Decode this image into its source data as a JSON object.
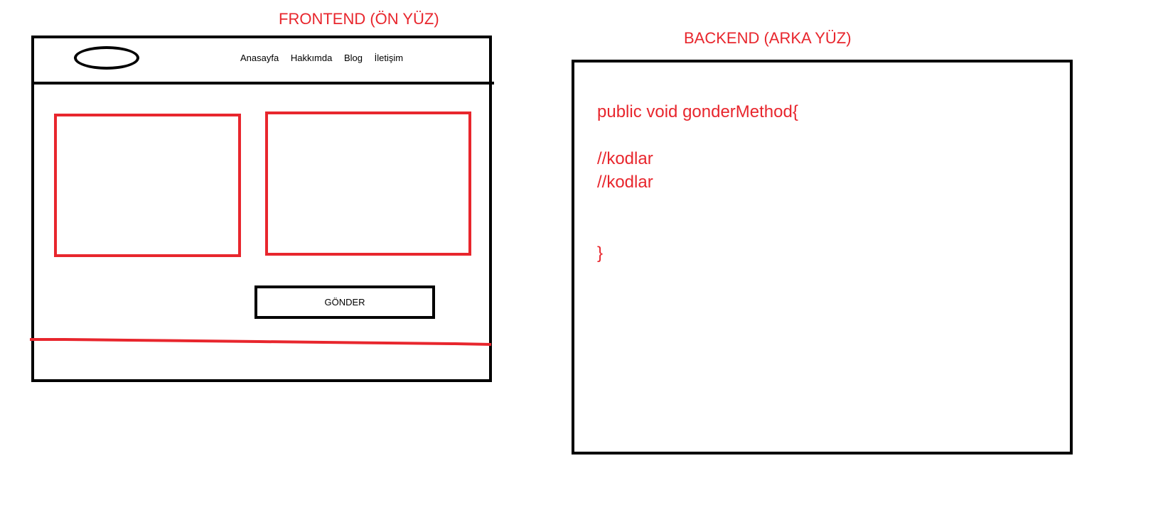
{
  "frontend": {
    "title": "FRONTEND (ÖN YÜZ)",
    "nav": [
      "Anasayfa",
      "Hakkımda",
      "Blog",
      "İletişim"
    ],
    "button_label": "GÖNDER"
  },
  "backend": {
    "title": "BACKEND (ARKA YÜZ)",
    "code": [
      "public void gonderMethod{",
      "//kodlar",
      "//kodlar",
      "}"
    ]
  },
  "colors": {
    "accent_red": "#e8262d",
    "outline_black": "#000000"
  }
}
